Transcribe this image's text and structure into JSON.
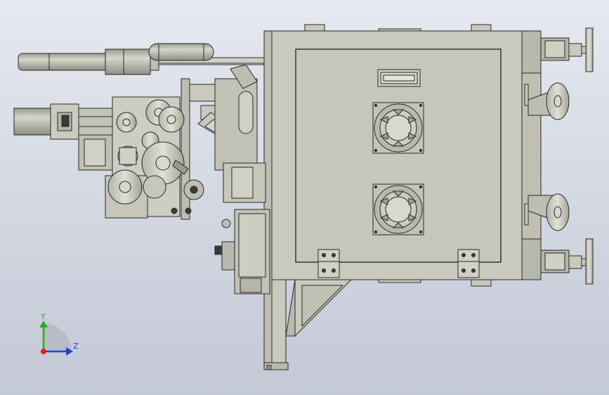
{
  "viewport": {
    "background_top": "#e6e9f0",
    "background_bottom": "#c3c9d5"
  },
  "colors": {
    "part_fill": "#c9c9bd",
    "part_fill_light": "#d8d8ce",
    "part_fill_dark": "#a9a99d",
    "edge": "#2a2a2a",
    "axis_x": "#e02020",
    "axis_y": "#20b020",
    "axis_z": "#2040e0"
  },
  "triad": {
    "y_label": "Y",
    "z_label": "Z"
  }
}
